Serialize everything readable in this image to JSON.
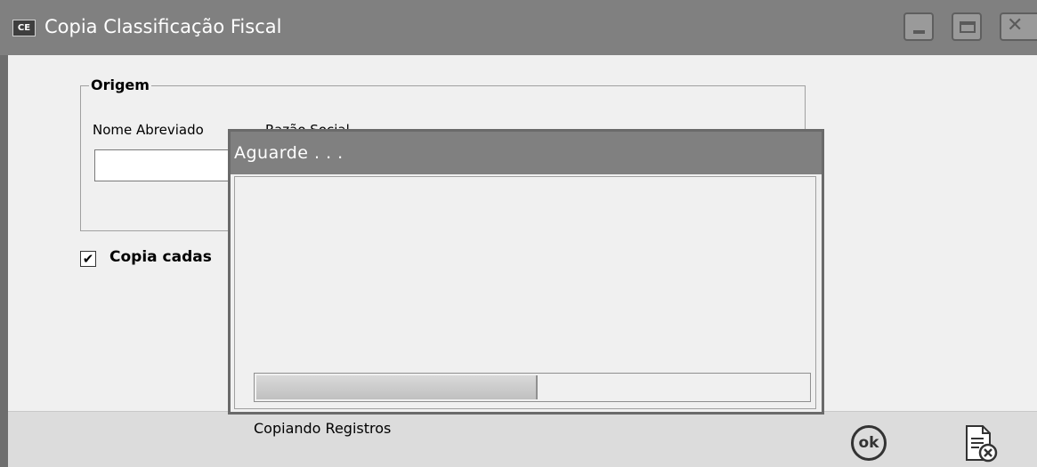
{
  "window": {
    "app_icon_text": "CE",
    "title": "Copia Classificação Fiscal"
  },
  "form": {
    "group_title": "Origem",
    "field_label_nome": "Nome Abreviado",
    "field_label_razao": "Razão Social",
    "nome_value": "",
    "checkbox_label": "Copia cadas",
    "checkbox_checked": true,
    "checkbox_mark": "✔"
  },
  "footer": {
    "ok_label": "ok"
  },
  "modal": {
    "title": "Aguarde . . .",
    "progress_fraction": 0.51,
    "status_text": "Copiando Registros"
  },
  "colors": {
    "titlebar": "#808080",
    "window_bg": "#f0f0f0",
    "footer_bg": "#dcdcdc"
  },
  "icons": {
    "minimize": "minimize-icon",
    "maximize": "maximize-icon",
    "close": "close-icon",
    "ok": "ok-icon",
    "cancel": "cancel-document-icon"
  }
}
